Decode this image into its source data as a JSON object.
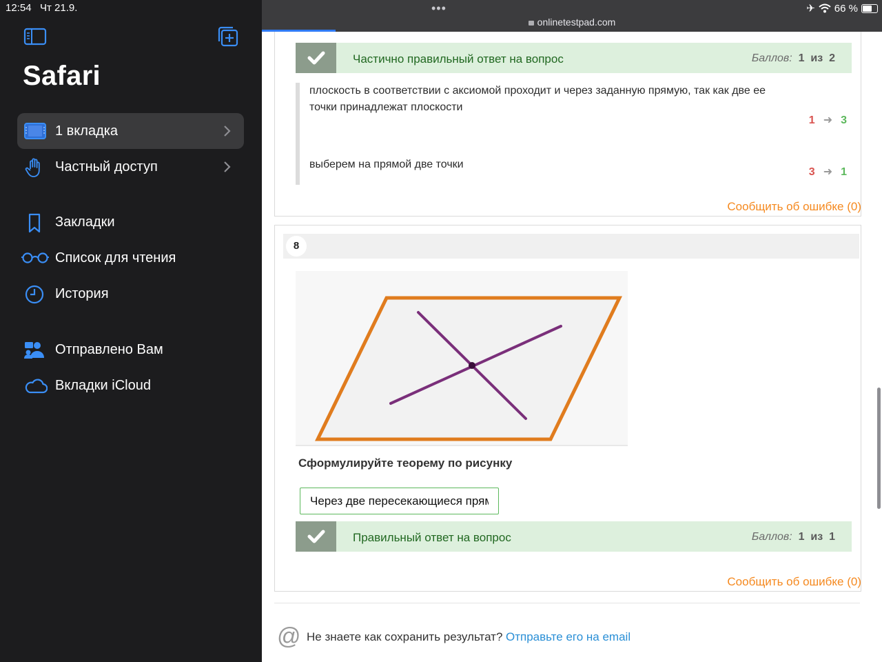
{
  "status_bar": {
    "time": "12:54",
    "date": "Чт 21.9.",
    "battery": "66 %"
  },
  "sidebar": {
    "title": "Safari",
    "items": [
      {
        "label": "1 вкладка",
        "icon": "tabs-icon"
      },
      {
        "label": "Частный доступ",
        "icon": "hand-icon"
      },
      {
        "label": "Закладки",
        "icon": "bookmark-icon"
      },
      {
        "label": "Список для чтения",
        "icon": "glasses-icon"
      },
      {
        "label": "История",
        "icon": "clock-icon"
      },
      {
        "label": "Отправлено Вам",
        "icon": "shared-people-icon"
      },
      {
        "label": "Вкладки iCloud",
        "icon": "cloud-icon"
      }
    ]
  },
  "browser": {
    "dots": "•••",
    "url": "onlinetestpad.com",
    "accent": "#2f7bf5"
  },
  "q7": {
    "result_text": "Частично правильный ответ на вопрос",
    "score_label": "Баллов:",
    "score_value": "1",
    "score_of": "из",
    "score_max": "2",
    "answers": [
      {
        "text": "плоскость в соответствии с аксиомой проходит и через заданную прямую, так как две ее точки принадлежат плоскости",
        "given": "1",
        "correct": "3"
      },
      {
        "text": "выберем на прямой две точки",
        "given": "3",
        "correct": "1"
      }
    ],
    "arrow": "➜",
    "report": "Сообщить об ошибке (0)"
  },
  "q8": {
    "number": "8",
    "question": "Сформулируйте теорему по рисунку",
    "answer_value": "Через две пересекающиеся прям",
    "result_text": "Правильный ответ на вопрос",
    "score_label": "Баллов:",
    "score_value": "1",
    "score_of": "из",
    "score_max": "1",
    "report": "Сообщить об ошибке (0)"
  },
  "footer": {
    "at_icon": "@",
    "question": "Не знаете как сохранить результат?",
    "link": "Отправьте его на email"
  },
  "colors": {
    "sidebar_bg": "#1c1c1e",
    "result_bg": "#ddf0dd",
    "report": "#f5891f",
    "link": "#2a8fd6"
  }
}
